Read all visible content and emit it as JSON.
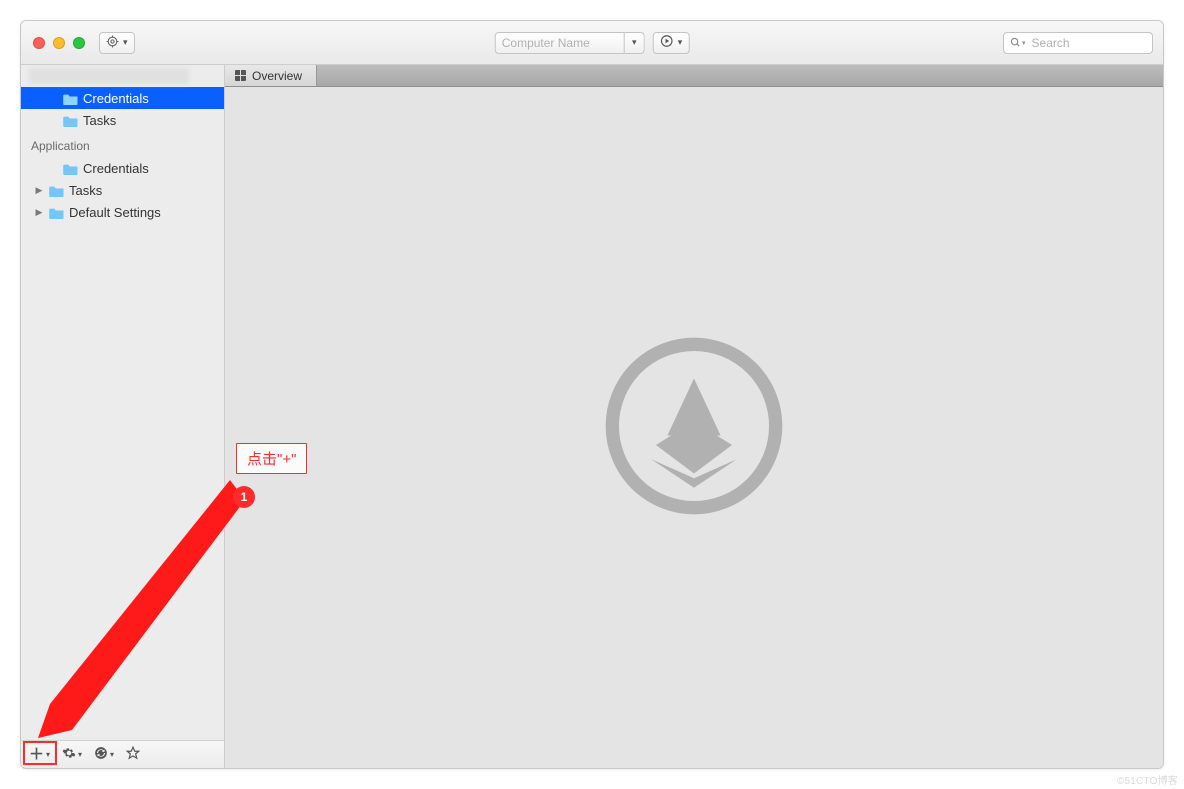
{
  "toolbar": {
    "combo_label": "Computer Name",
    "search_placeholder": "Search"
  },
  "sidebar": {
    "top_group": [
      {
        "label": "Credentials",
        "selected": true,
        "expandable": false
      },
      {
        "label": "Tasks",
        "selected": false,
        "expandable": false
      }
    ],
    "app_group_header": "Application",
    "app_group": [
      {
        "label": "Credentials",
        "expandable": false
      },
      {
        "label": "Tasks",
        "expandable": true
      },
      {
        "label": "Default Settings",
        "expandable": true
      }
    ]
  },
  "tabs": {
    "overview_label": "Overview"
  },
  "annotation": {
    "callout_text": "点击\"+\"",
    "step_number": "1"
  },
  "corner_watermark": "©51CTO博客"
}
